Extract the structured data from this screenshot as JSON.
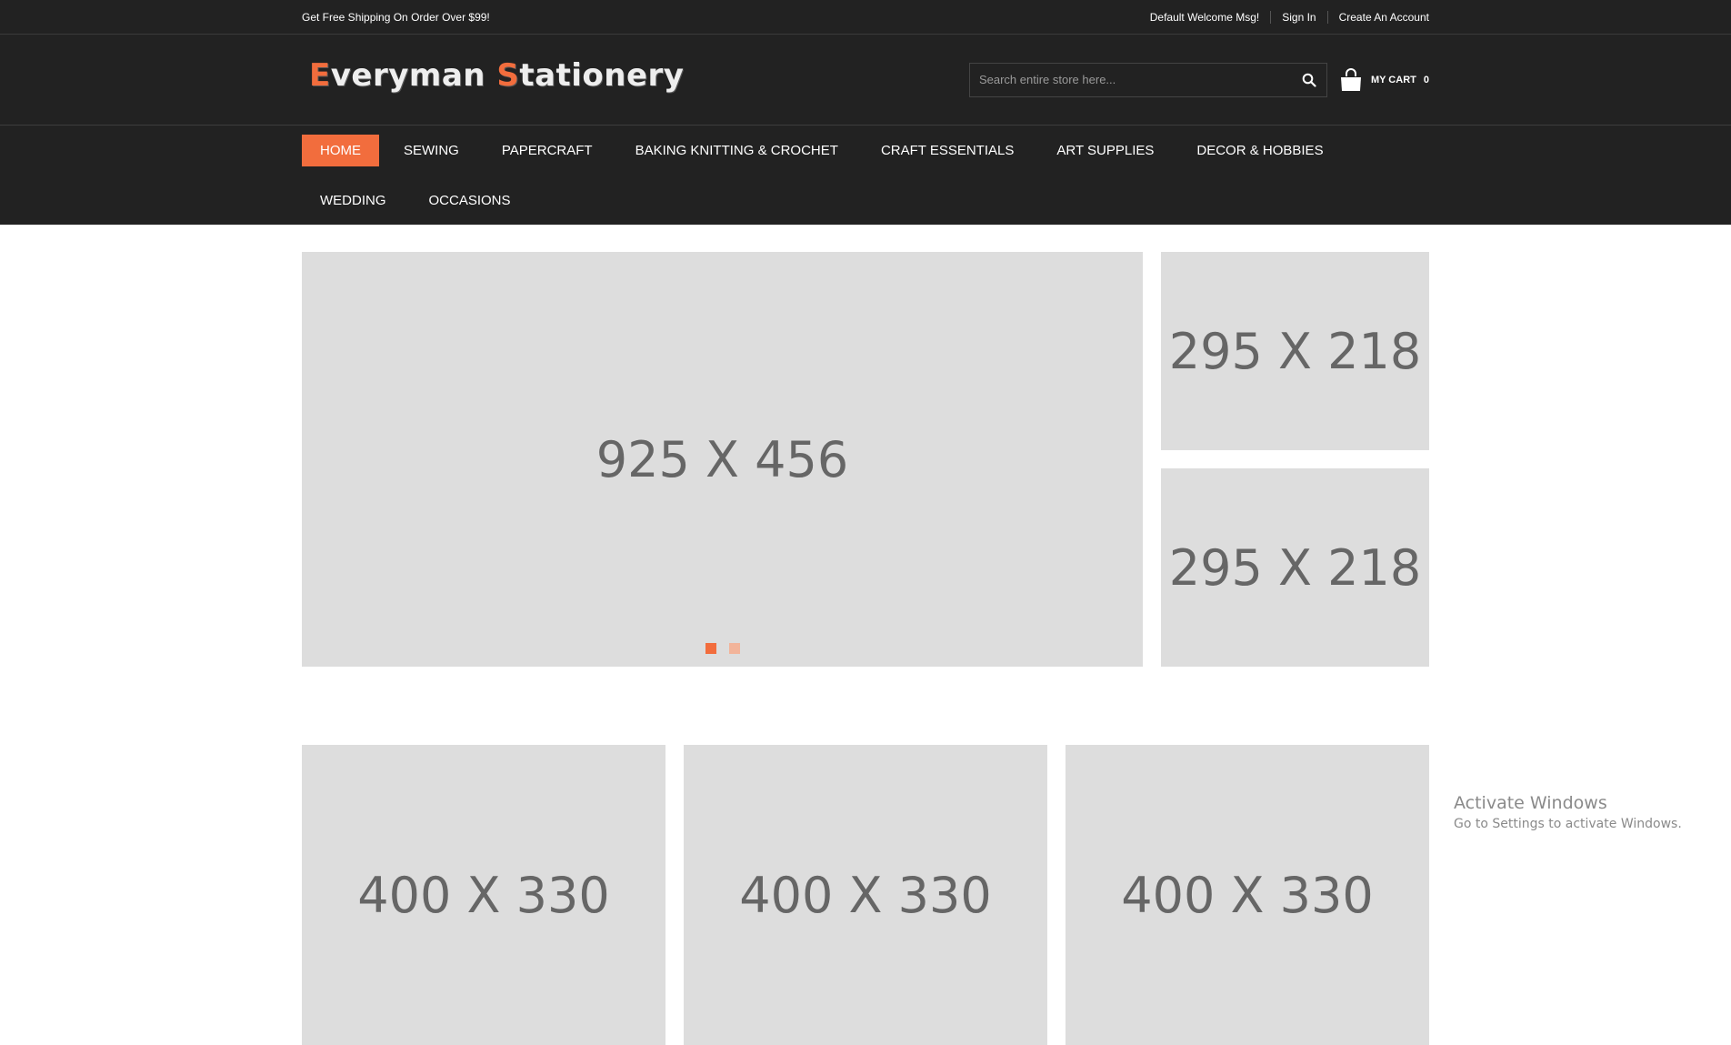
{
  "topbar": {
    "promo": "Get Free Shipping On Order Over $99!",
    "welcome": "Default Welcome Msg!",
    "sign_in": "Sign In",
    "create_account": "Create An Account"
  },
  "logo": {
    "text_e": "E",
    "text_rest1": "veryman ",
    "text_s": "S",
    "text_rest2": "tationery"
  },
  "search": {
    "placeholder": "Search entire store here..."
  },
  "cart": {
    "label": "MY CART",
    "count": "0"
  },
  "nav": {
    "items": [
      "HOME",
      "SEWING",
      "PAPERCRAFT",
      "BAKING KNITTING & CROCHET",
      "CRAFT ESSENTIALS",
      "ART SUPPLIES",
      "DECOR & HOBBIES",
      "WEDDING",
      "OCCASIONS"
    ],
    "active_index": 0
  },
  "banners": {
    "main": "925 X 456",
    "side_top": "295 X 218",
    "side_bottom": "295 X 218",
    "row2": [
      "400 X 330",
      "400 X 330",
      "400 X 330"
    ]
  },
  "slider": {
    "dots": 2,
    "active_dot": 0
  },
  "watermark": {
    "title": "Activate Windows",
    "subtitle": "Go to Settings to activate Windows."
  },
  "colors": {
    "accent": "#f26d3d",
    "header_bg": "#222222",
    "placeholder_bg": "#dddddd"
  },
  "icons": {
    "search": "search-icon",
    "cart": "shopping-bag-icon"
  }
}
